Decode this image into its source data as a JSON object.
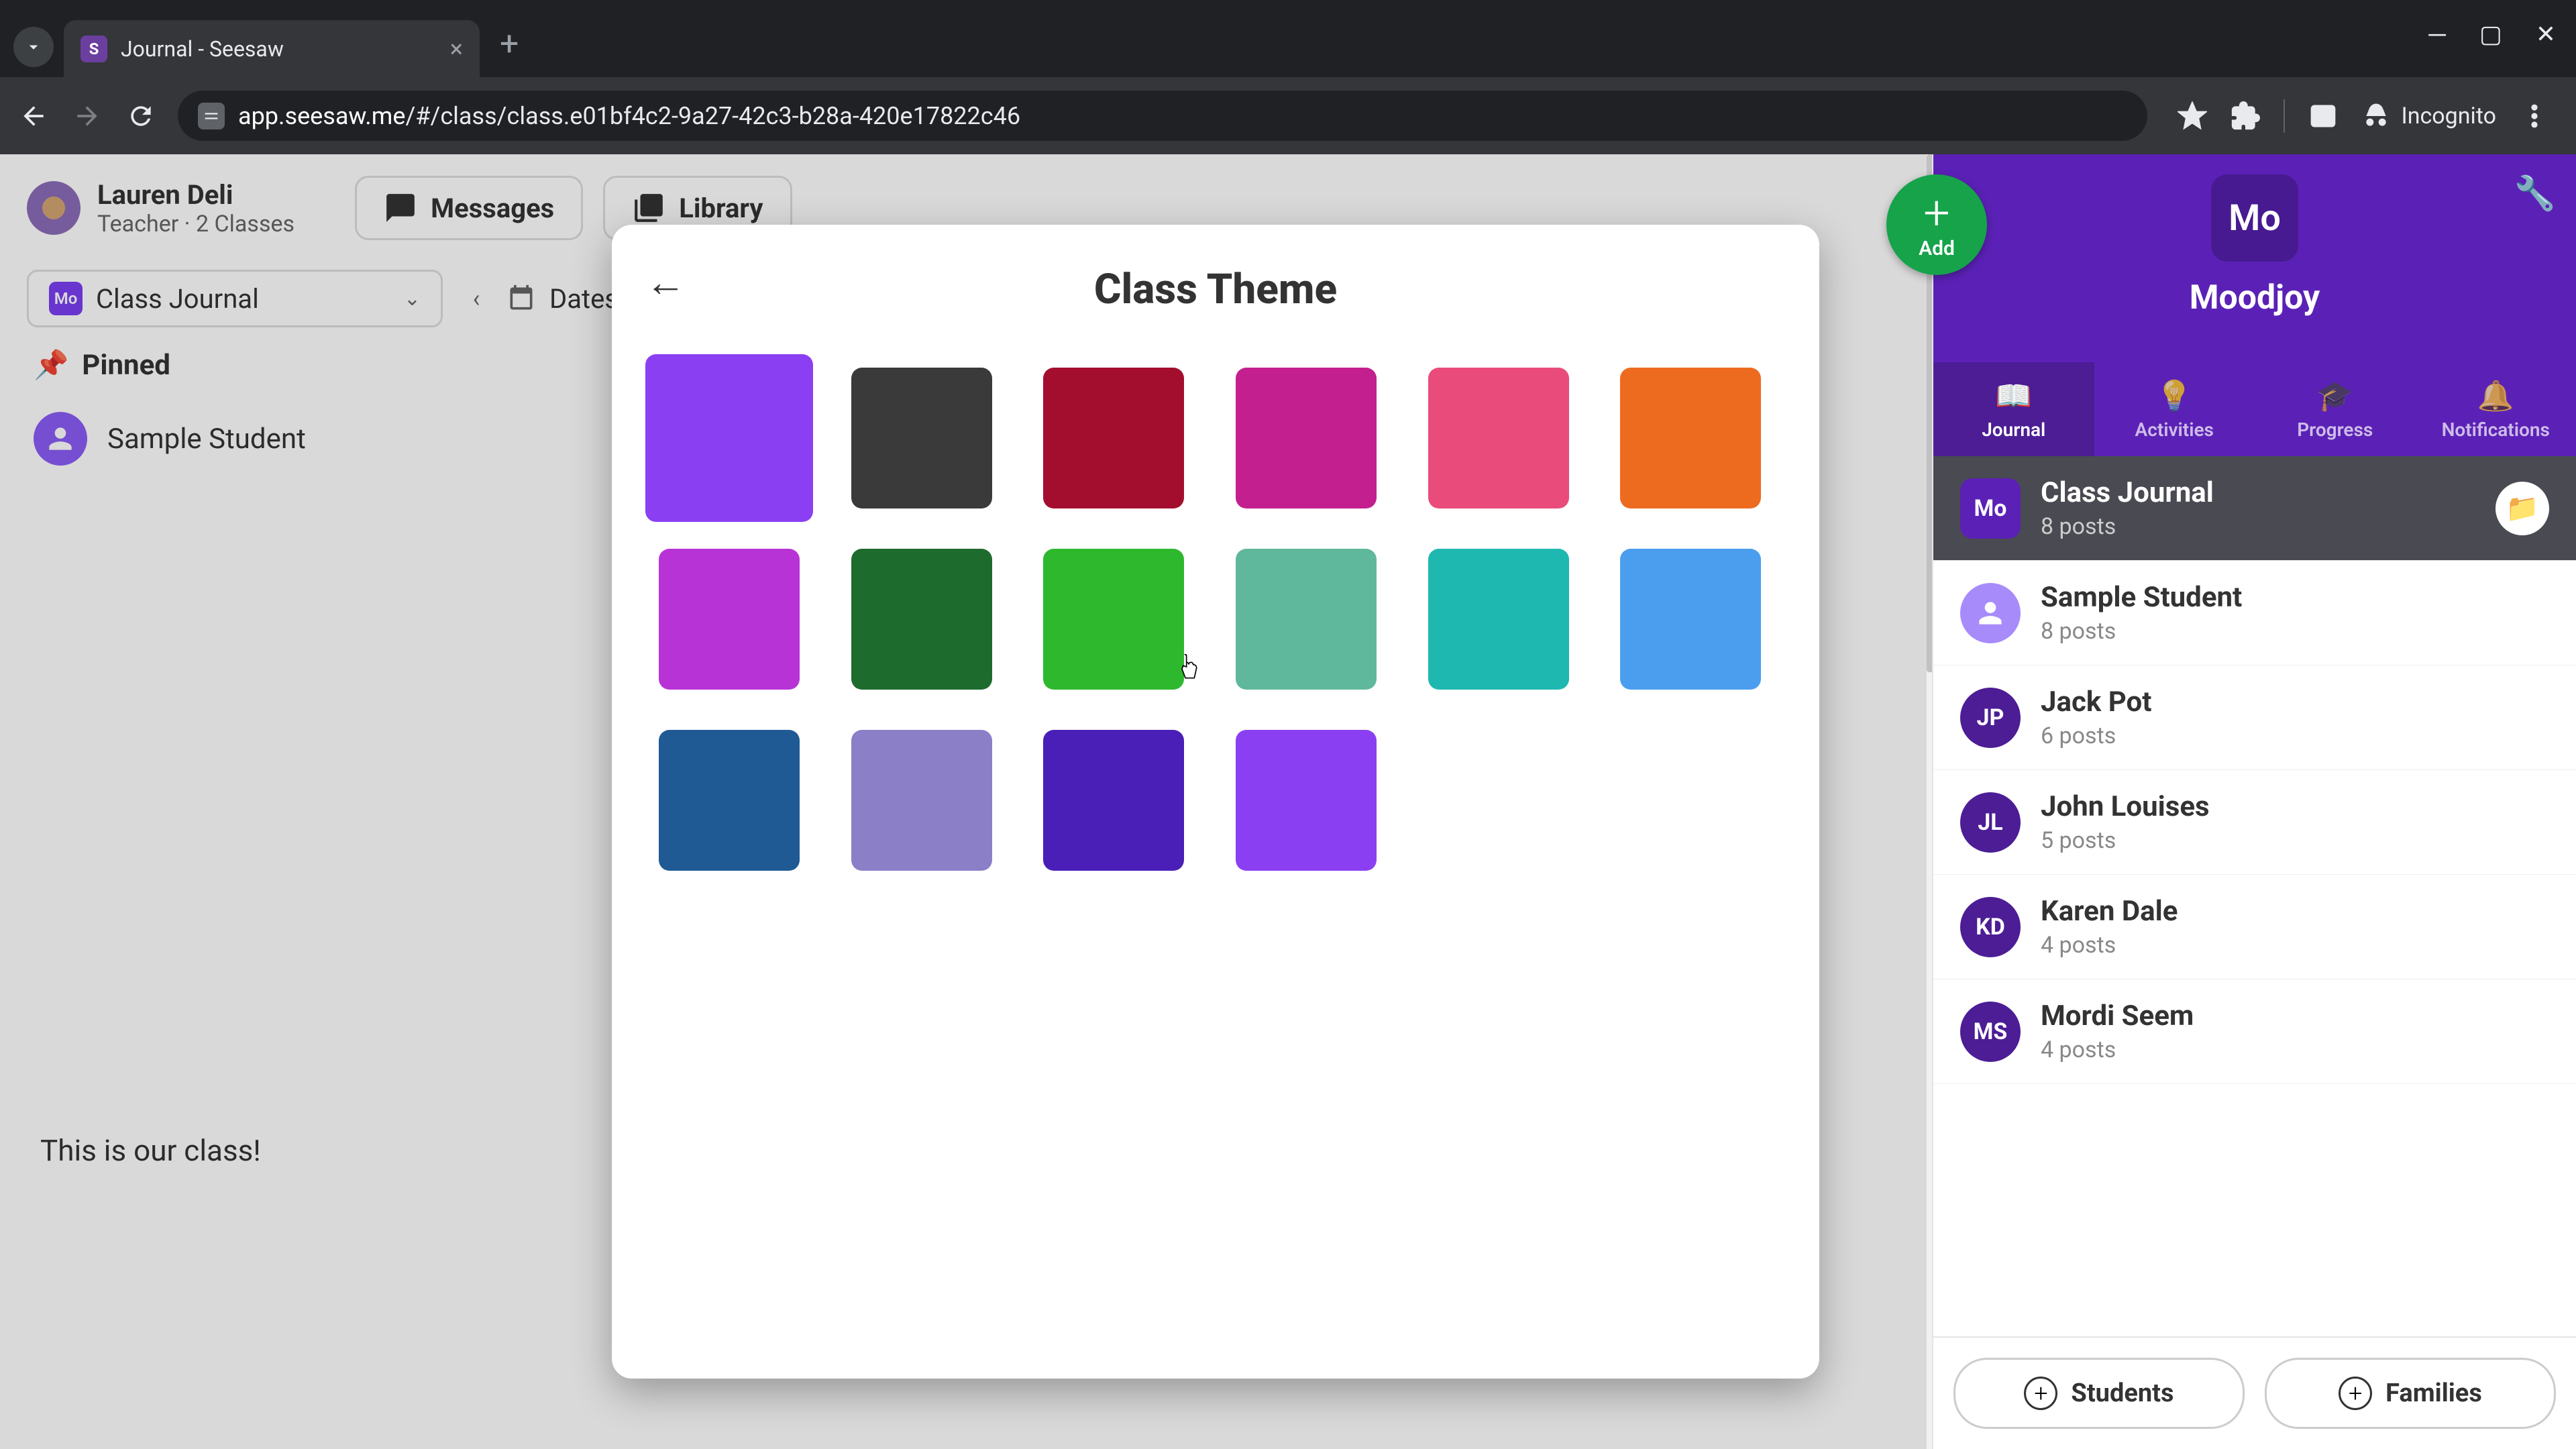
{
  "browser": {
    "tab_title": "Journal - Seesaw",
    "url_prefix": "app.seesaw.me",
    "url_path": "/#/class/class.e01bf4c2-9a27-42c3-b28a-420e17822c46",
    "incognito_label": "Incognito"
  },
  "header": {
    "user_name": "Lauren Deli",
    "user_role": "Teacher · 2 Classes",
    "messages_label": "Messages",
    "library_label": "Library"
  },
  "filter": {
    "class_badge": "Mo",
    "class_name": "Class Journal",
    "dates_label": "Dates"
  },
  "pinned": {
    "label": "Pinned",
    "student": "Sample Student"
  },
  "post": {
    "caption": "This is our class!"
  },
  "sidebar": {
    "add_label": "Add",
    "class_badge": "Mo",
    "class_name": "Moodjoy",
    "tabs": {
      "journal": "Journal",
      "activities": "Activities",
      "progress": "Progress",
      "notifications": "Notifications"
    },
    "students": [
      {
        "badge": "Mo",
        "name": "Class Journal",
        "posts": "8 posts",
        "active": true,
        "color": "#5b21b6",
        "is_badge": true
      },
      {
        "badge": "",
        "name": "Sample Student",
        "posts": "8 posts",
        "active": false,
        "color": "#a78bfa",
        "is_avatar": true
      },
      {
        "badge": "JP",
        "name": "Jack Pot",
        "posts": "6 posts",
        "active": false,
        "color": "#4c1d95"
      },
      {
        "badge": "JL",
        "name": "John Louises",
        "posts": "5 posts",
        "active": false,
        "color": "#4c1d95"
      },
      {
        "badge": "KD",
        "name": "Karen Dale",
        "posts": "4 posts",
        "active": false,
        "color": "#4c1d95"
      },
      {
        "badge": "MS",
        "name": "Mordi Seem",
        "posts": "4 posts",
        "active": false,
        "color": "#4c1d95"
      }
    ],
    "footer": {
      "students_label": "Students",
      "families_label": "Families"
    }
  },
  "modal": {
    "title": "Class Theme",
    "colors": [
      {
        "hex": "#8b3ff2",
        "selected": true,
        "name": "purple"
      },
      {
        "hex": "#3a3a3a",
        "name": "dark-gray"
      },
      {
        "hex": "#a30e2e",
        "name": "crimson"
      },
      {
        "hex": "#c41f8e",
        "name": "magenta"
      },
      {
        "hex": "#e94b7b",
        "name": "pink"
      },
      {
        "hex": "#ed6b1f",
        "name": "orange"
      },
      {
        "hex": "#b833d6",
        "name": "violet"
      },
      {
        "hex": "#1e6b2e",
        "name": "dark-green"
      },
      {
        "hex": "#2eb82e",
        "name": "green"
      },
      {
        "hex": "#5fb89c",
        "name": "sea-green"
      },
      {
        "hex": "#1fb8b0",
        "name": "teal"
      },
      {
        "hex": "#4a9eed",
        "name": "sky-blue"
      },
      {
        "hex": "#1f5a94",
        "name": "navy"
      },
      {
        "hex": "#8b7fc7",
        "name": "lavender"
      },
      {
        "hex": "#4a1fb8",
        "name": "indigo"
      },
      {
        "hex": "#8b3ff2",
        "name": "bright-purple"
      }
    ]
  }
}
